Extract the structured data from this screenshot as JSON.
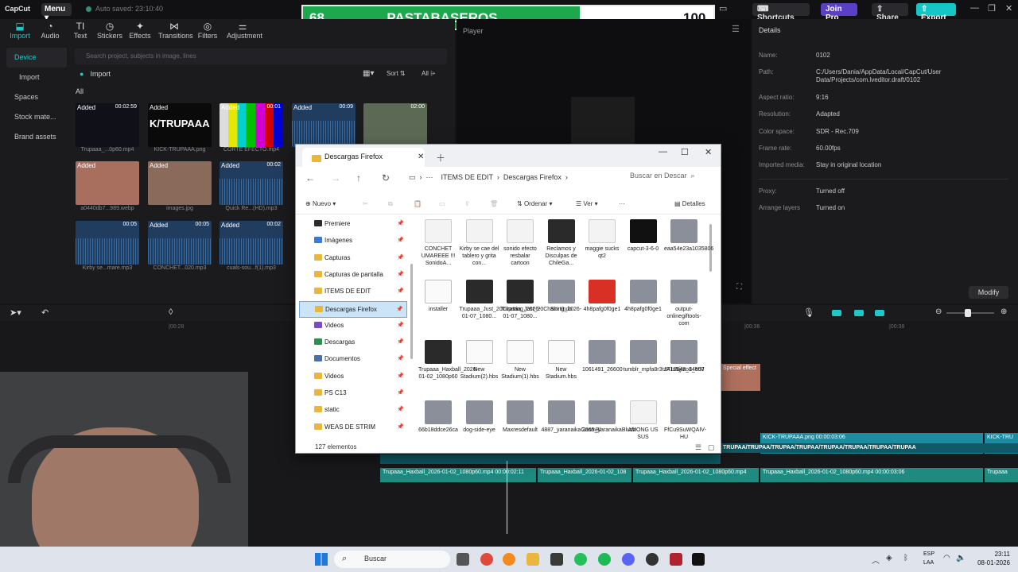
{
  "app": {
    "logo": "CapCut",
    "menu_label": "Menu",
    "autosave": "Auto saved: 23:10:40"
  },
  "scoreboard": {
    "left_score": "68",
    "team": "PASTABASEROS",
    "right_score": "100"
  },
  "topbar": {
    "shortcuts": "Shortcuts",
    "join_pro": "Join Pro",
    "share": "Share",
    "export": "Export"
  },
  "toolbar": [
    "Import",
    "Audio",
    "Text",
    "Stickers",
    "Effects",
    "Transitions",
    "Filters",
    "Adjustment"
  ],
  "sidebar": [
    "Device",
    "Import",
    "Spaces",
    "Stock mate...",
    "Brand assets"
  ],
  "media": {
    "search_placeholder": "Search project, subjects in image, lines",
    "import_label": "Import",
    "all_label": "All",
    "sort_label": "Sort",
    "filter_label": "All",
    "items": [
      {
        "tag": "Added",
        "duration": "00:02:59",
        "caption": "Trupaaa_...0p60.mp4"
      },
      {
        "tag": "Added",
        "duration": "",
        "caption": "KICK-TRUPAAA.png"
      },
      {
        "tag": "Added",
        "duration": "00:01",
        "caption": "CORTE EFECTO.mp4"
      },
      {
        "tag": "Added",
        "duration": "00:09",
        "caption": ""
      },
      {
        "tag": "",
        "duration": "02:00",
        "caption": ""
      },
      {
        "tag": "Added",
        "duration": "",
        "caption": "a0440db7...989.webp"
      },
      {
        "tag": "Added",
        "duration": "",
        "caption": "images.jpg"
      },
      {
        "tag": "Added",
        "duration": "00:02",
        "caption": "Quick Re...(HD).mp3"
      },
      {
        "tag": "",
        "duration": "00:05",
        "caption": "Kirby se...mare.mp3"
      },
      {
        "tag": "Added",
        "duration": "00:05",
        "caption": "CONCHET...020.mp3"
      },
      {
        "tag": "Added",
        "duration": "00:02",
        "caption": "cuals-sou...f(1).mp3"
      }
    ]
  },
  "player": {
    "title": "Player"
  },
  "details": {
    "title": "Details",
    "rows": [
      {
        "k": "Name:",
        "v": "0102"
      },
      {
        "k": "Path:",
        "v": "C:/Users/Dania/AppData/Local/CapCut/User Data/Projects/com.lveditor.draft/0102"
      },
      {
        "k": "Aspect ratio:",
        "v": "9:16"
      },
      {
        "k": "Resolution:",
        "v": "Adapted"
      },
      {
        "k": "Color space:",
        "v": "SDR - Rec.709"
      },
      {
        "k": "Frame rate:",
        "v": "60.00fps"
      },
      {
        "k": "Imported media:",
        "v": "Stay in original location"
      },
      {
        "k": "Proxy:",
        "v": "Turned off"
      },
      {
        "k": "Arrange layers",
        "v": "Turned on"
      }
    ],
    "modify": "Modify"
  },
  "timeline": {
    "ticks": [
      "|00:28",
      "|00:36",
      "|00:38"
    ],
    "effect_label": "Special effect",
    "clip_kick": "KICK-TRUPAAA.png  00:00:03:06",
    "clip_kick_b": "KICK-TRU",
    "clip_watermark": "TRUPAA/TRUPAA/TRUPAA/TRUPAA/TRUPAA/TRUPAA/TRUPAA/TRUPAA",
    "clip_video_a": "Trupaaa_Haxball_2026-01-02_1080p60.mp4  00:00:02:11",
    "clip_video_b": "Trupaaa_Haxball_2026-01-02_108",
    "clip_video_c": "Trupaaa_Haxball_2026-01-02_1080p60.mp4",
    "clip_video_d": "Trupaaa_Haxball_2026-01-02_1080p60.mp4  00:00:03:06",
    "clip_video_e": "Trupaaa"
  },
  "explorer": {
    "tab_title": "Descargas Firefox",
    "breadcrumb": [
      "ITEMS DE EDIT",
      "Descargas Firefox"
    ],
    "search_placeholder": "Buscar en Descar",
    "cmd": {
      "new": "Nuevo",
      "sort": "Ordenar",
      "view": "Ver",
      "details": "Detalles"
    },
    "nav": [
      {
        "label": "Premiere",
        "color": "#2b2b2b"
      },
      {
        "label": "Imágenes",
        "color": "#3a7bd5"
      },
      {
        "label": "Capturas",
        "color": "#e9b73e"
      },
      {
        "label": "Capturas de pantalla",
        "color": "#e9b73e"
      },
      {
        "label": "ITEMS DE EDIT",
        "color": "#e9b73e"
      },
      {
        "label": "Descargas Firefox",
        "color": "#e9b73e"
      },
      {
        "label": "Videos",
        "color": "#7b4bc4"
      },
      {
        "label": "Descargas",
        "color": "#2f8f52"
      },
      {
        "label": "Documentos",
        "color": "#4a6fa5"
      },
      {
        "label": "Videos",
        "color": "#e9b73e"
      },
      {
        "label": "PS C13",
        "color": "#e9b73e"
      },
      {
        "label": "static",
        "color": "#e9b73e"
      },
      {
        "label": "WEAS DE STRIM",
        "color": "#e9b73e"
      }
    ],
    "files": [
      {
        "name": "CONCHET UMAREEE !!! SonidoA...",
        "kind": "audio"
      },
      {
        "name": "Kirby se cae del tablero y grita con...",
        "kind": "audio"
      },
      {
        "name": "sonido efecto resbalar cartoon",
        "kind": "audio"
      },
      {
        "name": "Reclamos y Disculpas de ChileGa...",
        "kind": "video"
      },
      {
        "name": "maggie sucks qt2",
        "kind": "audio"
      },
      {
        "name": "capcut-3-6-0",
        "kind": "app"
      },
      {
        "name": "eaa54e23a1035806",
        "kind": "image"
      },
      {
        "name": "installer",
        "kind": "doc"
      },
      {
        "name": "Trupaaa_Just_20Chatting_2026-01-07_1080...",
        "kind": "video"
      },
      {
        "name": "Trupaaa_Just_20Chatting_2026-01-07_1080...",
        "kind": "video"
      },
      {
        "name": "Sin título",
        "kind": "image"
      },
      {
        "name": "4h8pafg0f0ge1",
        "kind": "pdf"
      },
      {
        "name": "4h8pafg0f0ge1",
        "kind": "image"
      },
      {
        "name": "output-onlinegiftools-com",
        "kind": "image"
      },
      {
        "name": "Trupaaa_Haxball_2026-01-02_1080p60",
        "kind": "video"
      },
      {
        "name": "New Stadium(2).hbs",
        "kind": "doc"
      },
      {
        "name": "New Stadium(1).hbs",
        "kind": "doc"
      },
      {
        "name": "New Stadium.hbs",
        "kind": "doc"
      },
      {
        "name": "1061491_26600",
        "kind": "image"
      },
      {
        "name": "tumblr_mpfa8r3tzF1s5jjtzo1_500",
        "kind": "image"
      },
      {
        "name": "1410648_84e57",
        "kind": "image"
      },
      {
        "name": "66b18ddce26ca",
        "kind": "image"
      },
      {
        "name": "dog-side-eye",
        "kind": "image"
      },
      {
        "name": "Maxresdefault",
        "kind": "image"
      },
      {
        "name": "4887_yaranaikaGasmBl",
        "kind": "image"
      },
      {
        "name": "2065_yaranaikaBlush",
        "kind": "image"
      },
      {
        "name": "AMONG US SUS",
        "kind": "audio"
      },
      {
        "name": "FfCu9SuWQAIV-HU",
        "kind": "image"
      }
    ],
    "status": "127 elementos"
  },
  "taskbar": {
    "search": "Buscar",
    "lang1": "ESP",
    "lang2": "LAA",
    "time": "23:11",
    "date": "08-01-2026"
  },
  "colors": {
    "accent": "#1fc8c8",
    "score_green": "#1ea84d",
    "pro": "#5b3fc4"
  }
}
